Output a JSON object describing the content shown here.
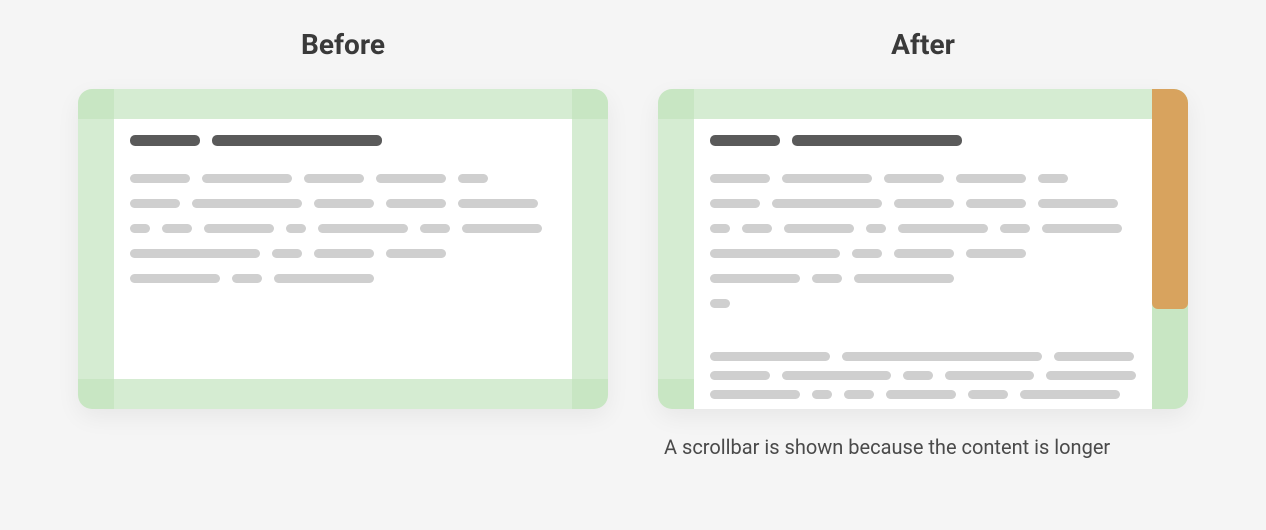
{
  "titles": {
    "before": "Before",
    "after": "After"
  },
  "caption_after": "A scrollbar is shown because the content is longer",
  "colors": {
    "frame": "#d5ecd2",
    "frame_corner": "#c8e6c3",
    "scrollbar_thumb": "#d8a35e",
    "placeholder_light": "#cfcfcf",
    "placeholder_dark": "#5a5a5a",
    "page_bg": "#f5f5f5"
  },
  "diagram": {
    "type": "before-after-comparison",
    "before": {
      "has_scrollbar": false,
      "content_rows": 6
    },
    "after": {
      "has_scrollbar": true,
      "content_rows": 10,
      "content_overflows": true
    }
  }
}
